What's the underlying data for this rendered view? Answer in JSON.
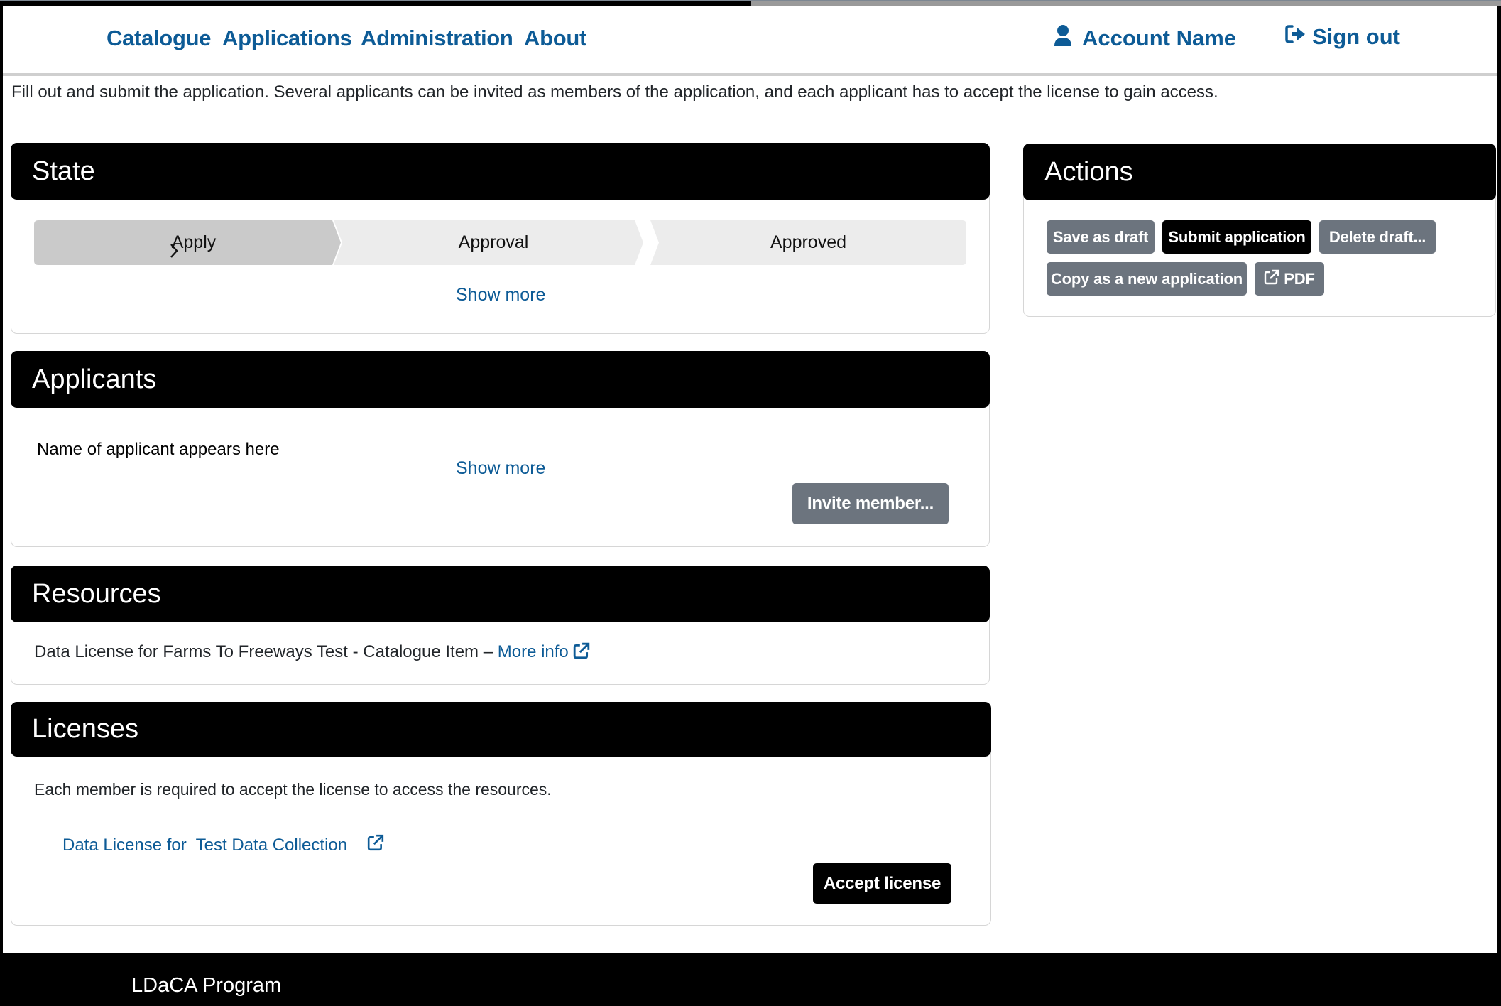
{
  "page_progress": 0.5,
  "nav": {
    "links": [
      "Catalogue",
      "Applications",
      "Administration",
      "About"
    ],
    "account_name": "Account Name",
    "sign_out": "Sign out",
    "account_icon": "user-icon",
    "sign_out_icon": "sign-out-icon"
  },
  "intro_text": "Fill out and submit the application. Several applicants can be invited as members of the application, and each applicant has to accept the license to gain access.",
  "state": {
    "title": "State",
    "steps": [
      {
        "label": "Apply",
        "active": true
      },
      {
        "label": "Approval",
        "active": false
      },
      {
        "label": "Approved",
        "active": false
      }
    ],
    "show_more": "Show more"
  },
  "applicants": {
    "title": "Applicants",
    "applicant_name": "Name of applicant appears here",
    "show_more": "Show more",
    "invite_button": "Invite member..."
  },
  "resources": {
    "title": "Resources",
    "item_text": "Data License for Farms To Freeways Test - Catalogue Item –",
    "more_info": "More info"
  },
  "licenses": {
    "title": "Licenses",
    "description": "Each member is required to accept the license to access the resources.",
    "license_link": "Data License for  Test Data Collection",
    "accept_button": "Accept license"
  },
  "actions": {
    "title": "Actions",
    "buttons": {
      "save_draft": "Save as draft",
      "submit": "Submit application",
      "delete_draft": "Delete draft...",
      "copy_new": "Copy as a new application",
      "pdf": "PDF"
    }
  },
  "footer": {
    "text": "LDaCA Program"
  },
  "colors": {
    "link": "#0d5b96",
    "header_bg": "#000000",
    "button_gray": "#6c747e",
    "button_primary": "#000000",
    "step_active": "#cacaca",
    "step_inactive": "#ececec"
  }
}
